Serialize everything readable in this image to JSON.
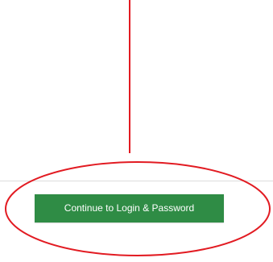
{
  "screen": {
    "background_color": "#ffffff",
    "divider_color": "#dcdcdc"
  },
  "action_bar": {
    "continue_button_label": "Continue to Login & Password",
    "button_color": "#2f8c45",
    "text_color": "#ffffff"
  },
  "annotation": {
    "color": "#e21b22",
    "arrow_icon": "vertical-line-arrow-icon",
    "highlight_icon": "ellipse-highlight-icon"
  }
}
